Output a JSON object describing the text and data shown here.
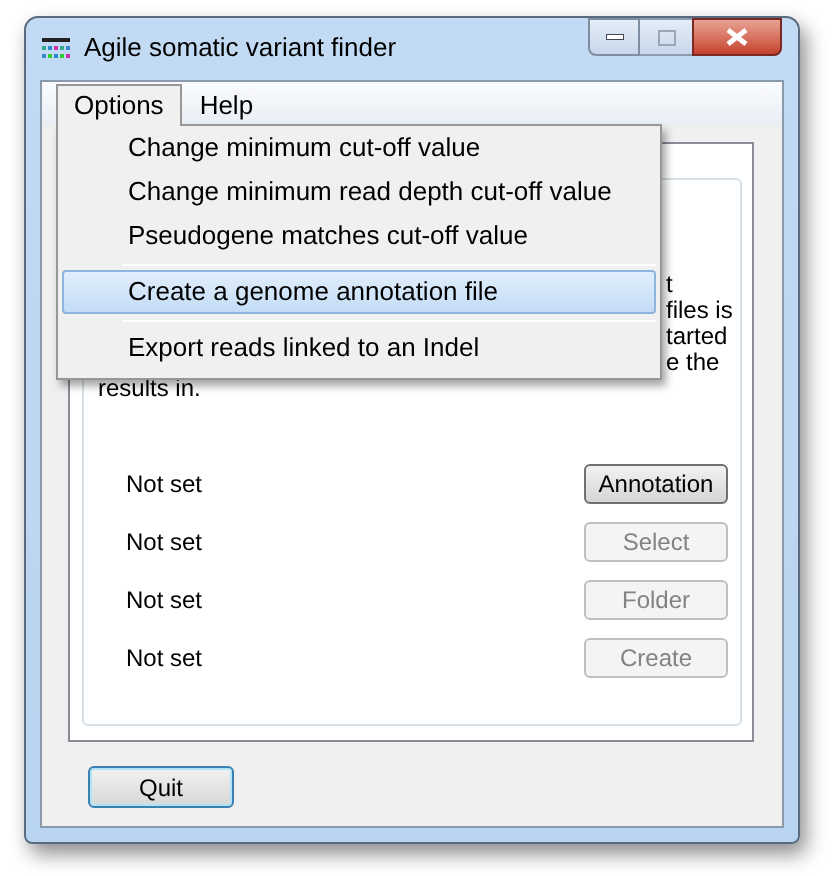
{
  "window": {
    "title": "Agile somatic variant finder"
  },
  "menu_bar": [
    {
      "label": "Options",
      "selected": true
    },
    {
      "label": "Help",
      "selected": false
    }
  ],
  "dropdown": [
    {
      "kind": "item",
      "label": "Change minimum cut-off value",
      "selected": false
    },
    {
      "kind": "item",
      "label": "Change minimum read depth cut-off value",
      "selected": false
    },
    {
      "kind": "item",
      "label": "Pseudogene matches cut-off value",
      "selected": false
    },
    {
      "kind": "separator"
    },
    {
      "kind": "item",
      "label": "Create a genome annotation file",
      "selected": true
    },
    {
      "kind": "separator"
    },
    {
      "kind": "item",
      "label": "Export reads linked to an Indel",
      "selected": false
    }
  ],
  "description": {
    "visible_fragments": [
      "t",
      "files is",
      "tarted",
      "e the"
    ],
    "last_line": "results in."
  },
  "rows": [
    {
      "status": "Not set",
      "button": "Annotation",
      "disabled": false
    },
    {
      "status": "Not set",
      "button": "Select",
      "disabled": true
    },
    {
      "status": "Not set",
      "button": "Folder",
      "disabled": true
    },
    {
      "status": "Not set",
      "button": "Create",
      "disabled": true
    }
  ],
  "quit_button": {
    "label": "Quit",
    "focused": true
  }
}
